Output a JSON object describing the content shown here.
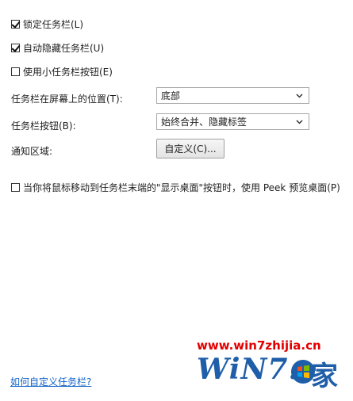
{
  "options": {
    "lock_taskbar": {
      "label": "锁定任务栏(L)",
      "checked": true
    },
    "auto_hide": {
      "label": "自动隐藏任务栏(U)",
      "checked": true
    },
    "small_buttons": {
      "label": "使用小任务栏按钮(E)",
      "checked": false
    }
  },
  "position": {
    "label": "任务栏在屏幕上的位置(T):",
    "value": "底部"
  },
  "buttons": {
    "label": "任务栏按钮(B):",
    "value": "始终合并、隐藏标签"
  },
  "notify": {
    "label": "通知区域:",
    "button_label": "自定义(C)..."
  },
  "peek": {
    "label": "当你将鼠标移动到任务栏末端的\"显示桌面\"按钮时，使用 Peek 预览桌面(P)",
    "checked": false
  },
  "help_link": "如何自定义任务栏?",
  "watermark": {
    "site": "www.win7zhijia.cn",
    "brand": "WiN7.",
    "jia": "家"
  },
  "colors": {
    "link": "#0f62c9",
    "watermark_red": "#e30000",
    "watermark_blue": "#1f5ea8"
  }
}
